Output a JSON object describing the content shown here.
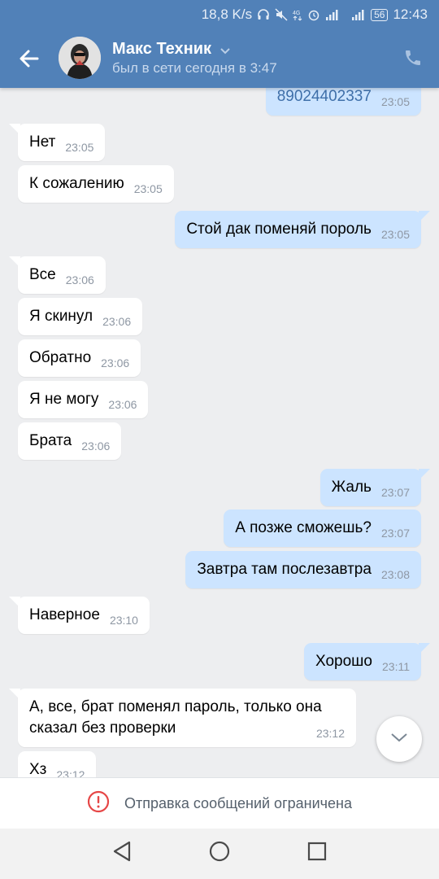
{
  "status_bar": {
    "speed": "18,8 K/s",
    "battery": "56",
    "time": "12:43"
  },
  "header": {
    "contact_name": "Макс Техник",
    "last_seen": "был в сети сегодня в 3:47"
  },
  "messages": [
    {
      "dir": "out",
      "text": "89024402337",
      "time": "23:05",
      "style": "phone"
    },
    {
      "dir": "in",
      "text": "Нет",
      "time": "23:05"
    },
    {
      "dir": "in",
      "text": "К сожалению",
      "time": "23:05"
    },
    {
      "dir": "out",
      "text": "Стой дак поменяй пороль",
      "time": "23:05"
    },
    {
      "dir": "in",
      "text": "Все",
      "time": "23:06"
    },
    {
      "dir": "in",
      "text": "Я скинул",
      "time": "23:06"
    },
    {
      "dir": "in",
      "text": "Обратно",
      "time": "23:06"
    },
    {
      "dir": "in",
      "text": "Я не могу",
      "time": "23:06"
    },
    {
      "dir": "in",
      "text": "Брата",
      "time": "23:06"
    },
    {
      "dir": "out",
      "text": "Жаль",
      "time": "23:07"
    },
    {
      "dir": "out",
      "text": "А позже сможешь?",
      "time": "23:07"
    },
    {
      "dir": "out",
      "text": "Завтра там послезавтра",
      "time": "23:08"
    },
    {
      "dir": "in",
      "text": "Наверное",
      "time": "23:10"
    },
    {
      "dir": "out",
      "text": "Хорошо",
      "time": "23:11"
    },
    {
      "dir": "in",
      "text": "А, все, брат поменял пароль, только она сказал без проверки",
      "time": "23:12"
    },
    {
      "dir": "in",
      "text": "Хз",
      "time": "23:12"
    }
  ],
  "restriction_text": "Отправка сообщений ограничена",
  "colors": {
    "header": "#5181b8",
    "incoming": "#ffffff",
    "outgoing": "#cce4ff",
    "background": "#edeef0",
    "alert": "#e64646"
  },
  "icons": [
    "back-arrow-icon",
    "chevron-down-icon",
    "phone-icon",
    "alert-icon",
    "scroll-down-icon",
    "nav-back-icon",
    "nav-home-icon",
    "nav-recents-icon"
  ]
}
